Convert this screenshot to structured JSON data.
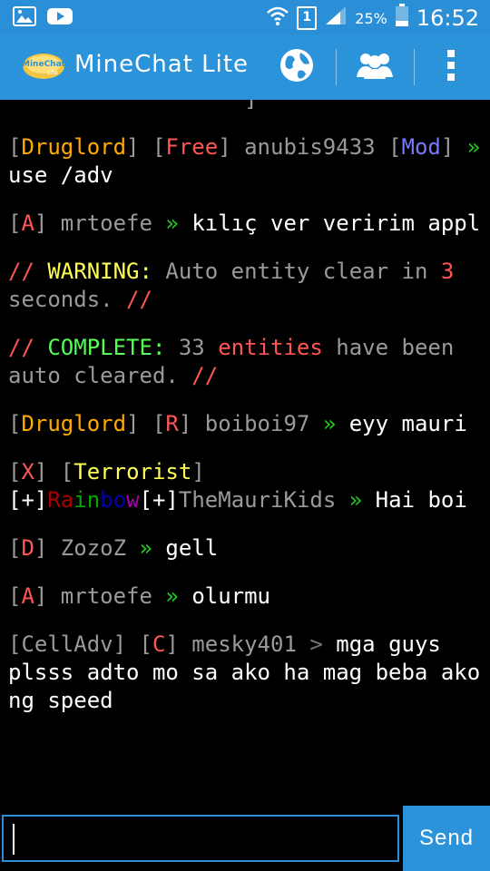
{
  "status_bar": {
    "battery_percent": "25%",
    "time": "16:52",
    "sim_slot": "1",
    "icons": [
      "image-icon",
      "youtube-icon",
      "wifi-icon",
      "sim-icon",
      "signal-icon",
      "battery-icon"
    ]
  },
  "action_bar": {
    "title": "MineChat Lite",
    "logo_text_top": "MineChat",
    "logo_text_bottom": "Lite",
    "icons": [
      "globe-icon",
      "users-icon",
      "overflow-menu-icon"
    ]
  },
  "colors": {
    "accent": "#2a93da",
    "gray": "#9a9a9a",
    "orange": "#ffaa00",
    "red": "#ff5555",
    "purple": "#5555ff",
    "green": "#55ff55",
    "yellow": "#ffff55",
    "aqua": "#55ffff",
    "white": "#ffffff"
  },
  "messages": [
    {
      "segments": [
        {
          "text": "[",
          "color": "#9a9a9a"
        },
        {
          "text": "Druglord",
          "color": "#ffaa00"
        },
        {
          "text": "] [",
          "color": "#9a9a9a"
        },
        {
          "text": "Free",
          "color": "#ff5555"
        },
        {
          "text": "] anubis9433 ",
          "color": "#9a9a9a"
        },
        {
          "text": "[",
          "color": "#9a9a9a"
        },
        {
          "text": "Mod",
          "color": "#7777ff"
        },
        {
          "text": "] ",
          "color": "#9a9a9a"
        },
        {
          "text": "» ",
          "color": "#22cc22"
        },
        {
          "text": "use /adv",
          "color": "#ffffff"
        }
      ]
    },
    {
      "segments": [
        {
          "text": "[",
          "color": "#9a9a9a"
        },
        {
          "text": "A",
          "color": "#ff5555"
        },
        {
          "text": "] mrtoefe ",
          "color": "#9a9a9a"
        },
        {
          "text": "» ",
          "color": "#22cc22"
        },
        {
          "text": "kılıç ver veririm appl",
          "color": "#ffffff"
        }
      ]
    },
    {
      "segments": [
        {
          "text": "// ",
          "color": "#ff5555"
        },
        {
          "text": "WARNING: ",
          "color": "#ffff55"
        },
        {
          "text": "Auto entity clear in ",
          "color": "#9a9a9a"
        },
        {
          "text": "3",
          "color": "#ff5555"
        },
        {
          "text": " seconds. ",
          "color": "#9a9a9a"
        },
        {
          "text": "//",
          "color": "#ff5555"
        }
      ]
    },
    {
      "segments": [
        {
          "text": "// ",
          "color": "#ff5555"
        },
        {
          "text": "COMPLETE: ",
          "color": "#55ff55"
        },
        {
          "text": "33 ",
          "color": "#9a9a9a"
        },
        {
          "text": "entities",
          "color": "#ff5555"
        },
        {
          "text": " have been auto cleared. ",
          "color": "#9a9a9a"
        },
        {
          "text": "//",
          "color": "#ff5555"
        }
      ]
    },
    {
      "segments": [
        {
          "text": "[",
          "color": "#9a9a9a"
        },
        {
          "text": "Druglord",
          "color": "#ffaa00"
        },
        {
          "text": "] [",
          "color": "#9a9a9a"
        },
        {
          "text": "R",
          "color": "#ff5555"
        },
        {
          "text": "] boiboi97 ",
          "color": "#9a9a9a"
        },
        {
          "text": "» ",
          "color": "#22cc22"
        },
        {
          "text": "eyy mauri",
          "color": "#ffffff"
        }
      ]
    },
    {
      "segments": [
        {
          "text": "[",
          "color": "#9a9a9a"
        },
        {
          "text": "X",
          "color": "#ff5555"
        },
        {
          "text": "] [",
          "color": "#9a9a9a"
        },
        {
          "text": "Terrorist",
          "color": "#ffff55"
        },
        {
          "text": "]\n",
          "color": "#9a9a9a"
        },
        {
          "text": "[+]",
          "color": "#ffffff"
        },
        {
          "text": "Ra",
          "color": "#aa0000"
        },
        {
          "text": "in",
          "color": "#00aa00"
        },
        {
          "text": "bo",
          "color": "#0000aa"
        },
        {
          "text": "w",
          "color": "#aa00aa"
        },
        {
          "text": "[+]",
          "color": "#ffffff"
        },
        {
          "text": "TheMauriKids ",
          "color": "#9a9a9a"
        },
        {
          "text": "» ",
          "color": "#22cc22"
        },
        {
          "text": "Hai boi",
          "color": "#ffffff"
        }
      ]
    },
    {
      "segments": [
        {
          "text": "[",
          "color": "#9a9a9a"
        },
        {
          "text": "D",
          "color": "#ff5555"
        },
        {
          "text": "] ZozoZ ",
          "color": "#9a9a9a"
        },
        {
          "text": "» ",
          "color": "#22cc22"
        },
        {
          "text": "gell",
          "color": "#ffffff"
        }
      ]
    },
    {
      "segments": [
        {
          "text": "[",
          "color": "#9a9a9a"
        },
        {
          "text": "A",
          "color": "#ff5555"
        },
        {
          "text": "] mrtoefe ",
          "color": "#9a9a9a"
        },
        {
          "text": "» ",
          "color": "#22cc22"
        },
        {
          "text": "olurmu",
          "color": "#ffffff"
        }
      ]
    },
    {
      "segments": [
        {
          "text": "[CellAdv] ",
          "color": "#9a9a9a"
        },
        {
          "text": "[",
          "color": "#9a9a9a"
        },
        {
          "text": "C",
          "color": "#ff5555"
        },
        {
          "text": "] mesky401 ",
          "color": "#9a9a9a"
        },
        {
          "text": "> ",
          "color": "#777777"
        },
        {
          "text": "mga guys plsss adto mo sa ako ha mag beba ako ng speed",
          "color": "#ffffff"
        }
      ]
    }
  ],
  "input": {
    "value": "",
    "placeholder": ""
  },
  "send_label": "Send"
}
